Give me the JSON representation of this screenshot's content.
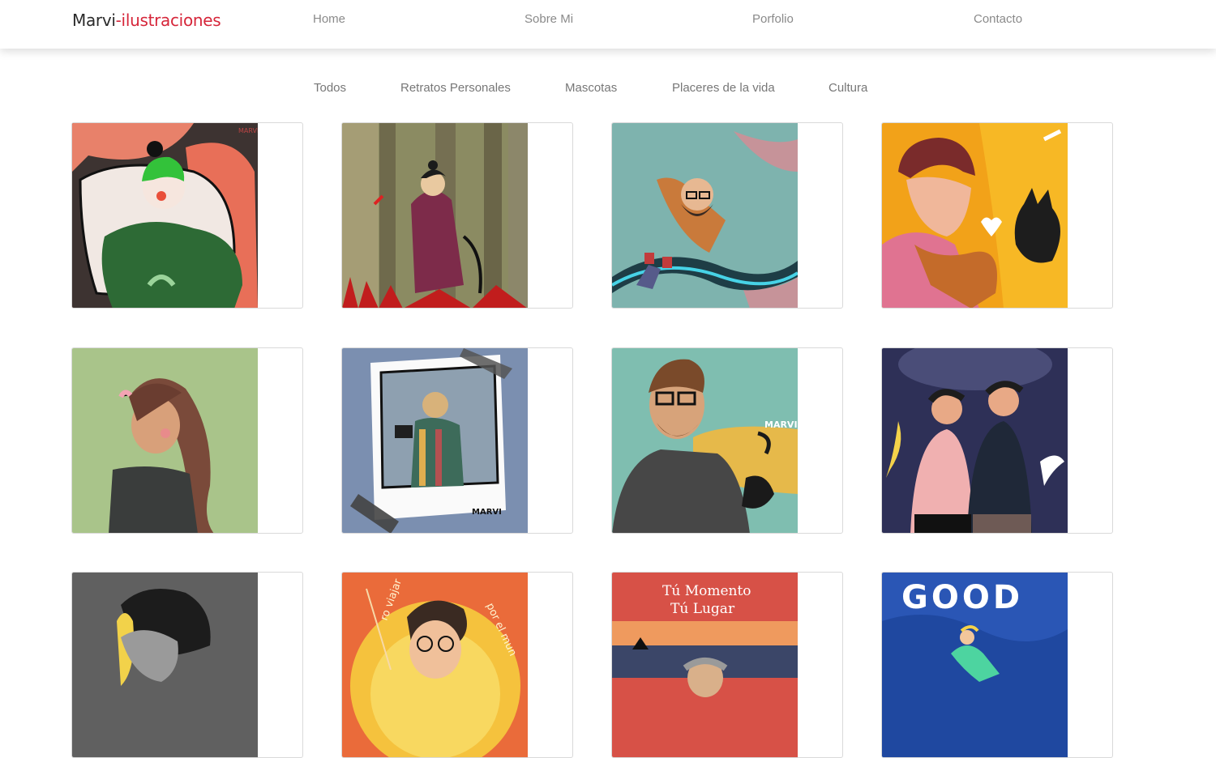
{
  "navbar": {
    "brand_primary": "Marvi",
    "brand_accent": "-ilustraciones",
    "links": [
      "Home",
      "Sobre Mi",
      "Porfolio",
      "Contacto"
    ]
  },
  "filters": [
    "Todos",
    "Retratos Personales",
    "Mascotas",
    "Placeres de la vida",
    "Cultura"
  ],
  "gallery": {
    "captions": {
      "ticket": "Tú Momento Tú Lugar",
      "good": "GOOD",
      "viajar": "ro viajar",
      "mundo": "por el mun",
      "sig": "MARVI"
    }
  },
  "colors": {
    "brand_accent": "#d6263a",
    "nav_text": "#8a8a8a"
  }
}
